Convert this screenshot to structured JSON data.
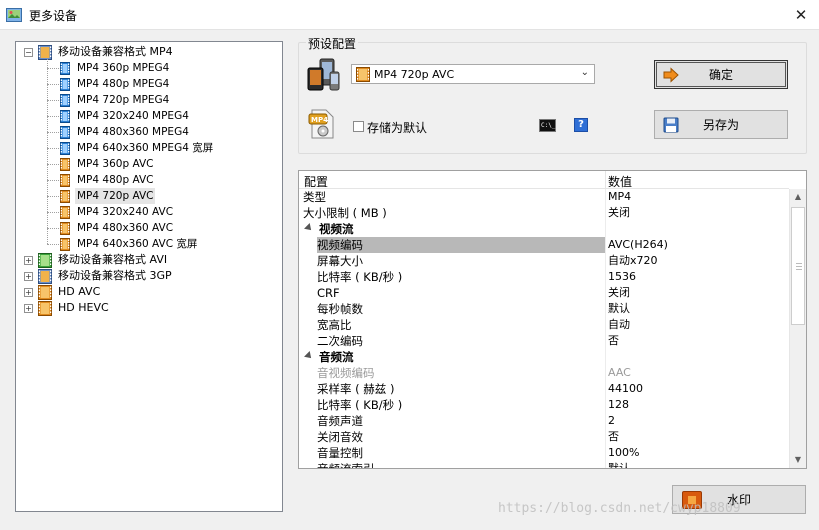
{
  "window": {
    "title": "更多设备",
    "close_glyph": "✕"
  },
  "tree": {
    "root": {
      "label": "移动设备兼容格式 MP4",
      "expander": "−"
    },
    "children": [
      {
        "label": "MP4 360p MPEG4",
        "icon": "film-blue"
      },
      {
        "label": "MP4 480p MPEG4",
        "icon": "film-blue"
      },
      {
        "label": "MP4 720p MPEG4",
        "icon": "film-blue"
      },
      {
        "label": "MP4 320x240 MPEG4",
        "icon": "film-blue"
      },
      {
        "label": "MP4 480x360 MPEG4",
        "icon": "film-blue"
      },
      {
        "label": "MP4 640x360 MPEG4 宽屏",
        "icon": "film-blue"
      },
      {
        "label": "MP4 360p AVC",
        "icon": "film-orange"
      },
      {
        "label": "MP4 480p AVC",
        "icon": "film-orange"
      },
      {
        "label": "MP4 720p AVC",
        "icon": "film-orange",
        "selected": true
      },
      {
        "label": "MP4 320x240 AVC",
        "icon": "film-orange"
      },
      {
        "label": "MP4 480x360 AVC",
        "icon": "film-orange"
      },
      {
        "label": "MP4 640x360 AVC 宽屏",
        "icon": "film-orange"
      }
    ],
    "others": [
      {
        "label": "移动设备兼容格式 AVI",
        "icon": "film-green",
        "expander": "+"
      },
      {
        "label": "移动设备兼容格式 3GP",
        "icon": "film-multi",
        "expander": "+"
      },
      {
        "label": "HD AVC",
        "icon": "film-orange",
        "expander": "+"
      },
      {
        "label": "HD HEVC",
        "icon": "film-orange",
        "expander": "+"
      }
    ]
  },
  "preset": {
    "group_title": "预设配置",
    "selected_value": "MP4 720p AVC",
    "combo_chevron": "⌄",
    "confirm_label": "确定",
    "save_default_label": "存储为默认",
    "save_as_label": "另存为",
    "cmd_glyph": "C:\\_",
    "help_glyph": "?"
  },
  "grid": {
    "header_name": "配置",
    "header_value": "数值",
    "rows": [
      {
        "name": "类型",
        "value": "MP4",
        "level": 0
      },
      {
        "name": "大小限制 ( MB )",
        "value": "关闭",
        "level": 0
      },
      {
        "name": "视频流",
        "value": "",
        "level": 1,
        "category": true
      },
      {
        "name": "视频编码",
        "value": "AVC(H264)",
        "level": 2,
        "highlight": true
      },
      {
        "name": "屏幕大小",
        "value": "自动x720",
        "level": 2
      },
      {
        "name": "比特率 ( KB/秒 )",
        "value": "1536",
        "level": 2
      },
      {
        "name": "CRF",
        "value": "关闭",
        "level": 2
      },
      {
        "name": "每秒帧数",
        "value": "默认",
        "level": 2
      },
      {
        "name": "宽高比",
        "value": "自动",
        "level": 2
      },
      {
        "name": "二次编码",
        "value": "否",
        "level": 2
      },
      {
        "name": "音频流",
        "value": "",
        "level": 1,
        "category": true
      },
      {
        "name": "音视频编码",
        "value": "AAC",
        "level": 2,
        "disabled": true
      },
      {
        "name": "采样率 ( 赫兹 )",
        "value": "44100",
        "level": 2
      },
      {
        "name": "比特率 ( KB/秒 )",
        "value": "128",
        "level": 2
      },
      {
        "name": "音频声道",
        "value": "2",
        "level": 2
      },
      {
        "name": "关闭音效",
        "value": "否",
        "level": 2
      },
      {
        "name": "音量控制",
        "value": "100%",
        "level": 2
      },
      {
        "name": "音频流索引",
        "value": "默认",
        "level": 2
      }
    ],
    "scroll_up": "▲",
    "scroll_down": "▼"
  },
  "footer": {
    "watermark_label": "水印",
    "blog_url": "https://blog.csdn.net/cwyp18809"
  }
}
